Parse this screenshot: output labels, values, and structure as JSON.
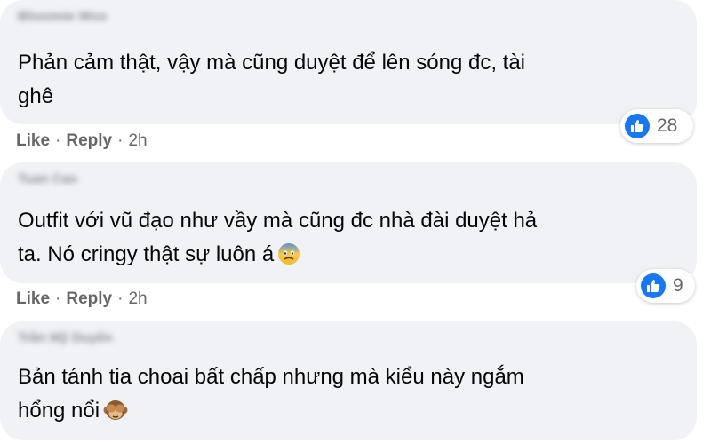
{
  "comments": [
    {
      "author": "Bhoomie Woo",
      "text_line1": "Phản cảm thật, vậy mà cũng duyệt để lên sóng đc, tài",
      "text_line2": "ghê",
      "like_label": "Like",
      "reply_label": "Reply",
      "time": "2h",
      "reaction_count": "28"
    },
    {
      "author": "Tuan Cao",
      "text_line1": "Outfit với vũ đạo như vầy mà cũng đc nhà đài duyệt hả",
      "text_line2": "ta. Nó cringy thật sự luôn á",
      "emoji": "anxious-face-with-sweat-icon",
      "like_label": "Like",
      "reply_label": "Reply",
      "time": "2h",
      "reaction_count": "9"
    },
    {
      "author": "Trần Mỹ Duyên",
      "text_line1": "Bản tánh tia choai bất chấp nhưng mà kiểu này ngắm",
      "text_line2": "hổng nổi",
      "emoji": "see-no-evil-monkey-icon"
    }
  ],
  "separator": "·",
  "colors": {
    "bubble": "#f0f2f5",
    "text": "#050505",
    "meta": "#65676b",
    "like_blue": "#1877f2"
  }
}
